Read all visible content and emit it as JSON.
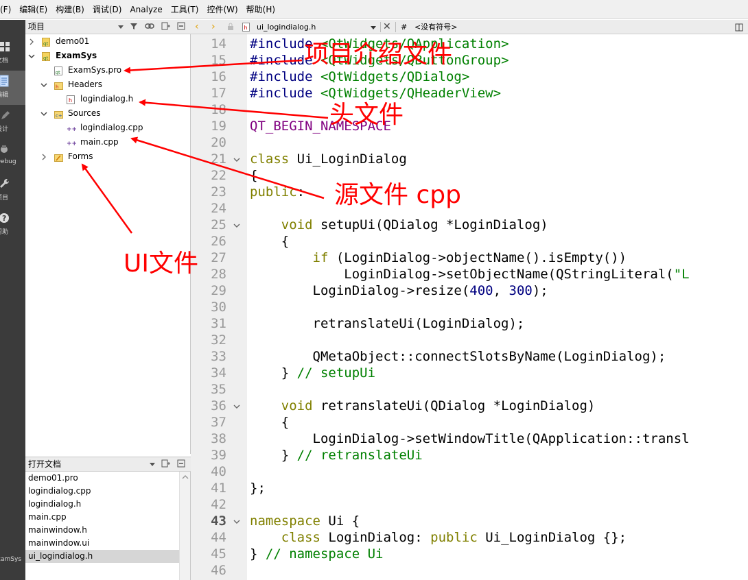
{
  "menu": [
    "(F)",
    "编辑(E)",
    "构建(B)",
    "调试(D)",
    "Analyze",
    "工具(T)",
    "控件(W)",
    "帮助(H)"
  ],
  "modes": [
    {
      "label": "文档",
      "icon": "grid-icon"
    },
    {
      "label": "编辑",
      "icon": "edit-document-icon",
      "active": true
    },
    {
      "label": "设计",
      "icon": "pencil-icon"
    },
    {
      "label": "Debug",
      "icon": "bug-icon"
    },
    {
      "label": "项目",
      "icon": "wrench-icon"
    },
    {
      "label": "帮助",
      "icon": "help-icon"
    }
  ],
  "mode_project_label": "ExamSys",
  "project_panel": {
    "title": "项目",
    "tree": [
      {
        "label": "demo01",
        "level": 0,
        "arrow": "›",
        "icon": "project-icon"
      },
      {
        "label": "ExamSys",
        "level": 0,
        "arrow": "⌄",
        "icon": "project-icon",
        "bold": true
      },
      {
        "label": "ExamSys.pro",
        "level": 1,
        "arrow": "",
        "icon": "pro-file-icon"
      },
      {
        "label": "Headers",
        "level": 1,
        "arrow": "⌄",
        "icon": "folder-h-icon"
      },
      {
        "label": "logindialog.h",
        "level": 2,
        "arrow": "",
        "icon": "header-file-icon"
      },
      {
        "label": "Sources",
        "level": 1,
        "arrow": "⌄",
        "icon": "folder-cpp-icon"
      },
      {
        "label": "logindialog.cpp",
        "level": 2,
        "arrow": "",
        "icon": "cpp-file-icon"
      },
      {
        "label": "main.cpp",
        "level": 2,
        "arrow": "",
        "icon": "cpp-file-icon"
      },
      {
        "label": "Forms",
        "level": 1,
        "arrow": "›",
        "icon": "folder-forms-icon"
      }
    ]
  },
  "docs_panel": {
    "title": "打开文档",
    "items": [
      "demo01.pro",
      "logindialog.cpp",
      "logindialog.h",
      "main.cpp",
      "mainwindow.h",
      "mainwindow.ui",
      "ui_logindialog.h"
    ],
    "selected_index": 6
  },
  "editor": {
    "file": "ui_logindialog.h",
    "symbol_hash": "#",
    "symbol": "<没有符号>",
    "current_line": 43,
    "lines": [
      {
        "n": 14,
        "fold": "",
        "html": "<span class=\"pre\">#include</span> <span class=\"inc\">&lt;QtWidgets/QApplication&gt;</span>"
      },
      {
        "n": 15,
        "fold": "",
        "html": "<span class=\"pre\">#include</span> <span class=\"inc\">&lt;QtWidgets/QButtonGroup&gt;</span>"
      },
      {
        "n": 16,
        "fold": "",
        "html": "<span class=\"pre\">#include</span> <span class=\"inc\">&lt;QtWidgets/QDialog&gt;</span>"
      },
      {
        "n": 17,
        "fold": "",
        "html": "<span class=\"pre\">#include</span> <span class=\"inc\">&lt;QtWidgets/QHeaderView&gt;</span>"
      },
      {
        "n": 18,
        "fold": "",
        "html": ""
      },
      {
        "n": 19,
        "fold": "",
        "html": "<span class=\"macro\">QT_BEGIN_NAMESPACE</span>"
      },
      {
        "n": 20,
        "fold": "",
        "html": ""
      },
      {
        "n": 21,
        "fold": "⌄",
        "html": "<span class=\"kw\">class</span> Ui_LoginDialog"
      },
      {
        "n": 22,
        "fold": "",
        "html": "{"
      },
      {
        "n": 23,
        "fold": "",
        "html": "<span class=\"kw\">public</span>:"
      },
      {
        "n": 24,
        "fold": "",
        "html": ""
      },
      {
        "n": 25,
        "fold": "⌄",
        "html": "    <span class=\"kw\">void</span> setupUi(QDialog *LoginDialog)"
      },
      {
        "n": 26,
        "fold": "",
        "html": "    {"
      },
      {
        "n": 27,
        "fold": "",
        "html": "        <span class=\"kw\">if</span> (LoginDialog-&gt;objectName().isEmpty())"
      },
      {
        "n": 28,
        "fold": "",
        "html": "            LoginDialog-&gt;setObjectName(QStringLiteral(<span class=\"inc\">\"L</span>"
      },
      {
        "n": 29,
        "fold": "",
        "html": "        LoginDialog-&gt;resize(<span class=\"num\">400</span>, <span class=\"num\">300</span>);"
      },
      {
        "n": 30,
        "fold": "",
        "html": ""
      },
      {
        "n": 31,
        "fold": "",
        "html": "        retranslateUi(LoginDialog);"
      },
      {
        "n": 32,
        "fold": "",
        "html": ""
      },
      {
        "n": 33,
        "fold": "",
        "html": "        QMetaObject::connectSlotsByName(LoginDialog);"
      },
      {
        "n": 34,
        "fold": "",
        "html": "    } <span class=\"cmt\">// setupUi</span>"
      },
      {
        "n": 35,
        "fold": "",
        "html": ""
      },
      {
        "n": 36,
        "fold": "⌄",
        "html": "    <span class=\"kw\">void</span> retranslateUi(QDialog *LoginDialog)"
      },
      {
        "n": 37,
        "fold": "",
        "html": "    {"
      },
      {
        "n": 38,
        "fold": "",
        "html": "        LoginDialog-&gt;setWindowTitle(QApplication::transl"
      },
      {
        "n": 39,
        "fold": "",
        "html": "    } <span class=\"cmt\">// retranslateUi</span>"
      },
      {
        "n": 40,
        "fold": "",
        "html": ""
      },
      {
        "n": 41,
        "fold": "",
        "html": "};"
      },
      {
        "n": 42,
        "fold": "",
        "html": ""
      },
      {
        "n": 43,
        "fold": "⌄",
        "html": "<span class=\"kw\">namespace</span> Ui {"
      },
      {
        "n": 44,
        "fold": "",
        "html": "    <span class=\"kw\">class</span> LoginDialog: <span class=\"kw\">public</span> Ui_LoginDialog {};"
      },
      {
        "n": 45,
        "fold": "",
        "html": "} <span class=\"cmt\">// namespace Ui</span>"
      },
      {
        "n": 46,
        "fold": "",
        "html": ""
      }
    ]
  },
  "annotations": [
    {
      "text": "项目介绍文件",
      "name": "annotation-project-file"
    },
    {
      "text": "头文件",
      "name": "annotation-header-file"
    },
    {
      "text": "源文件 cpp",
      "name": "annotation-source-file"
    },
    {
      "text": "UI文件",
      "name": "annotation-ui-file"
    }
  ],
  "colors": {
    "annotation": "#ff0000",
    "keyword": "#808000",
    "preprocessor": "#000080",
    "include": "#008000",
    "macro": "#800080"
  }
}
